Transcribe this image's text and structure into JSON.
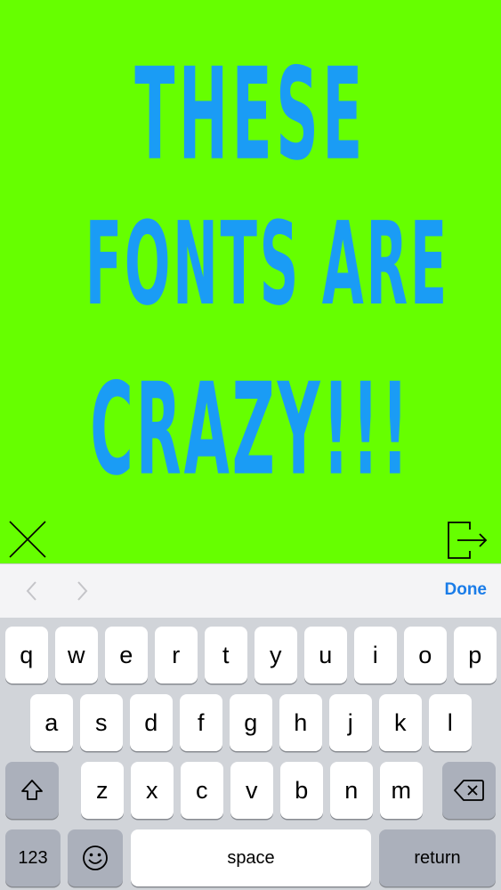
{
  "canvas": {
    "lines": [
      "THESE",
      "FONTS ARE",
      "CRAZY!!!"
    ],
    "text_color": "#1a9cf5",
    "background_color": "#66ff00"
  },
  "overlay": {
    "close_icon": "close-x-icon",
    "export_icon": "export-arrow-icon"
  },
  "toolbar": {
    "prev_icon": "chevron-left-icon",
    "next_icon": "chevron-right-icon",
    "done_label": "Done",
    "accent_color": "#1a7ce8"
  },
  "keyboard": {
    "row1": [
      "q",
      "w",
      "e",
      "r",
      "t",
      "y",
      "u",
      "i",
      "o",
      "p"
    ],
    "row2": [
      "a",
      "s",
      "d",
      "f",
      "g",
      "h",
      "j",
      "k",
      "l"
    ],
    "row3": [
      "z",
      "x",
      "c",
      "v",
      "b",
      "n",
      "m"
    ],
    "shift_icon": "shift-icon",
    "backspace_icon": "backspace-icon",
    "numbers_label": "123",
    "emoji_icon": "emoji-icon",
    "space_label": "space",
    "return_label": "return"
  }
}
